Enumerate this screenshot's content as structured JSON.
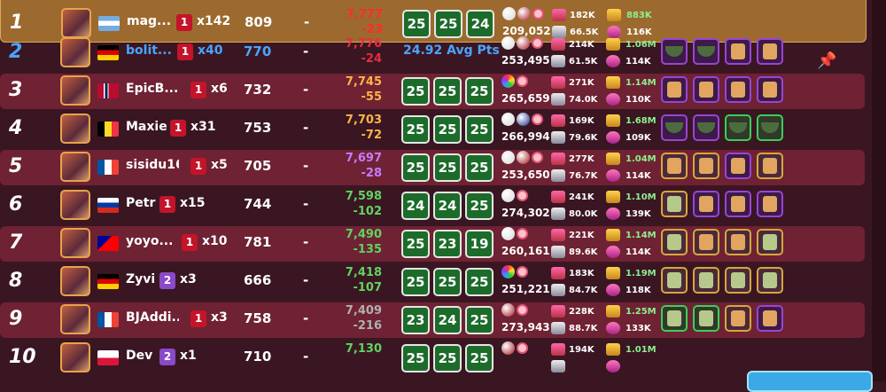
{
  "leaderboard": [
    {
      "rank": "1",
      "name": "mag...",
      "flag": "AR",
      "level": "1",
      "level_color": "red",
      "multiplier": "x142",
      "power": "809",
      "dash": "-",
      "points": "7,777",
      "delta": "-23",
      "points_color": "#ff2b2b",
      "scores": [
        "25",
        "25",
        "24"
      ],
      "avg": null,
      "orbs": [
        "#d7d7d7",
        "#a3141c"
      ],
      "big": "209,052",
      "stat1": "182K",
      "stat2": "66.5K",
      "stat3": "883K",
      "stat4": "116K",
      "items": [],
      "highlight": "me"
    },
    {
      "rank": "2",
      "name": "bolit...",
      "flag": "DE",
      "level": "1",
      "level_color": "red",
      "multiplier": "x40",
      "power": "770",
      "dash": "-",
      "points": "7,776",
      "delta": "-24",
      "points_color": "#e52f3f",
      "scores": [],
      "avg": "24.92 Avg Pts",
      "orbs": [
        "#d7d7d7",
        "#a3141c"
      ],
      "big": "253,495",
      "stat1": "214K",
      "stat2": "61.5K",
      "stat3": "1.06M",
      "stat4": "114K",
      "items": [
        "purple-bowl",
        "purple-bowl",
        "purple-figure",
        "purple-figure"
      ],
      "highlight": "blue"
    },
    {
      "rank": "3",
      "name": "EpicB...",
      "flag": "NO",
      "level": "1",
      "level_color": "red",
      "multiplier": "x6",
      "power": "732",
      "dash": "-",
      "points": "7,745",
      "delta": "-55",
      "points_color": "#ffb347",
      "scores": [
        "25",
        "25",
        "25"
      ],
      "avg": null,
      "orbs": [
        "rainbow"
      ],
      "big": "265,659",
      "stat1": "271K",
      "stat2": "74.0K",
      "stat3": "1.14M",
      "stat4": "110K",
      "items": [
        "purple-figure",
        "purple-figure",
        "purple-figure",
        "purple-figure"
      ],
      "highlight": "dark"
    },
    {
      "rank": "4",
      "name": "Maxie",
      "flag": "BE",
      "level": "1",
      "level_color": "red",
      "multiplier": "x31",
      "power": "753",
      "dash": "-",
      "points": "7,703",
      "delta": "-72",
      "points_color": "#ffb347",
      "scores": [
        "25",
        "25",
        "25"
      ],
      "avg": null,
      "orbs": [
        "#d7d7d7",
        "#1b2b8c"
      ],
      "big": "266,994",
      "stat1": "169K",
      "stat2": "79.6K",
      "stat3": "1.68M",
      "stat4": "109K",
      "items": [
        "purple-bowl",
        "purple-bowl",
        "green-bowl",
        "green-bowl"
      ],
      "highlight": "light"
    },
    {
      "rank": "5",
      "name": "sisidu16",
      "flag": "FR",
      "level": "1",
      "level_color": "red",
      "multiplier": "x5",
      "power": "705",
      "dash": "-",
      "points": "7,697",
      "delta": "-28",
      "points_color": "#c57cff",
      "scores": [
        "25",
        "25",
        "25"
      ],
      "avg": null,
      "orbs": [
        "#d7d7d7",
        "#a3141c"
      ],
      "big": "253,650",
      "stat1": "277K",
      "stat2": "76.7K",
      "stat3": "1.04M",
      "stat4": "114K",
      "items": [
        "gold-figure",
        "gold-figure",
        "purple-figure",
        "gold-figure"
      ],
      "highlight": "dark"
    },
    {
      "rank": "6",
      "name": "Petr",
      "flag": "RU",
      "level": "1",
      "level_color": "red",
      "multiplier": "x15",
      "power": "744",
      "dash": "-",
      "points": "7,598",
      "delta": "-102",
      "points_color": "#5fd45f",
      "scores": [
        "24",
        "24",
        "25"
      ],
      "avg": null,
      "orbs": [
        "#d7d7d7"
      ],
      "big": "274,302",
      "stat1": "241K",
      "stat2": "80.0K",
      "stat3": "1.10M",
      "stat4": "139K",
      "items": [
        "gold-leaf",
        "purple-figure",
        "purple-figure",
        "purple-figure"
      ],
      "highlight": "light"
    },
    {
      "rank": "7",
      "name": "yoyo...",
      "flag": "TW",
      "level": "1",
      "level_color": "red",
      "multiplier": "x10",
      "power": "781",
      "dash": "-",
      "points": "7,490",
      "delta": "-135",
      "points_color": "#5fd45f",
      "scores": [
        "25",
        "23",
        "19"
      ],
      "avg": null,
      "orbs": [
        "#d7d7d7"
      ],
      "big": "260,161",
      "stat1": "221K",
      "stat2": "89.6K",
      "stat3": "1.14M",
      "stat4": "114K",
      "items": [
        "gold-leaf",
        "gold-figure",
        "gold-figure",
        "gold-leaf"
      ],
      "highlight": "dark"
    },
    {
      "rank": "8",
      "name": "Zyvi",
      "flag": "DE",
      "level": "2",
      "level_color": "purple",
      "multiplier": "x3",
      "power": "666",
      "dash": "-",
      "points": "7,418",
      "delta": "-107",
      "points_color": "#5fd45f",
      "scores": [
        "25",
        "25",
        "25"
      ],
      "avg": null,
      "orbs": [
        "rainbow"
      ],
      "big": "251,221",
      "stat1": "183K",
      "stat2": "84.7K",
      "stat3": "1.19M",
      "stat4": "118K",
      "items": [
        "gold-leaf",
        "gold-leaf",
        "gold-leaf",
        "gold-leaf"
      ],
      "highlight": "light"
    },
    {
      "rank": "9",
      "name": "BJAddi...",
      "flag": "FR",
      "level": "1",
      "level_color": "red",
      "multiplier": "x3",
      "power": "758",
      "dash": "-",
      "points": "7,409",
      "delta": "-216",
      "points_color": "#b0b0b0",
      "scores": [
        "23",
        "24",
        "25"
      ],
      "avg": null,
      "orbs": [
        "#a3141c"
      ],
      "big": "273,943",
      "stat1": "228K",
      "stat2": "88.7K",
      "stat3": "1.25M",
      "stat4": "133K",
      "items": [
        "green-leaf",
        "green-leaf",
        "gold-figure",
        "purple-figure"
      ],
      "highlight": "dark"
    },
    {
      "rank": "10",
      "name": "Dev",
      "flag": "PL",
      "level": "2",
      "level_color": "purple",
      "multiplier": "x1",
      "power": "710",
      "dash": "-",
      "points": "7,130",
      "delta": "",
      "points_color": "#5fd45f",
      "scores": [
        "25",
        "25",
        "25"
      ],
      "avg": null,
      "orbs": [
        "#a3141c"
      ],
      "big": "",
      "stat1": "194K",
      "stat2": "",
      "stat3": "1.01M",
      "stat4": "",
      "items": [],
      "highlight": "light"
    }
  ],
  "colors": {
    "row_dark": "#6e2233",
    "row_me": "#9c6a2f",
    "score_green": "#1d6b2a",
    "accent_blue": "#4aa4ff"
  },
  "icons": {
    "pin": "pin-icon"
  }
}
